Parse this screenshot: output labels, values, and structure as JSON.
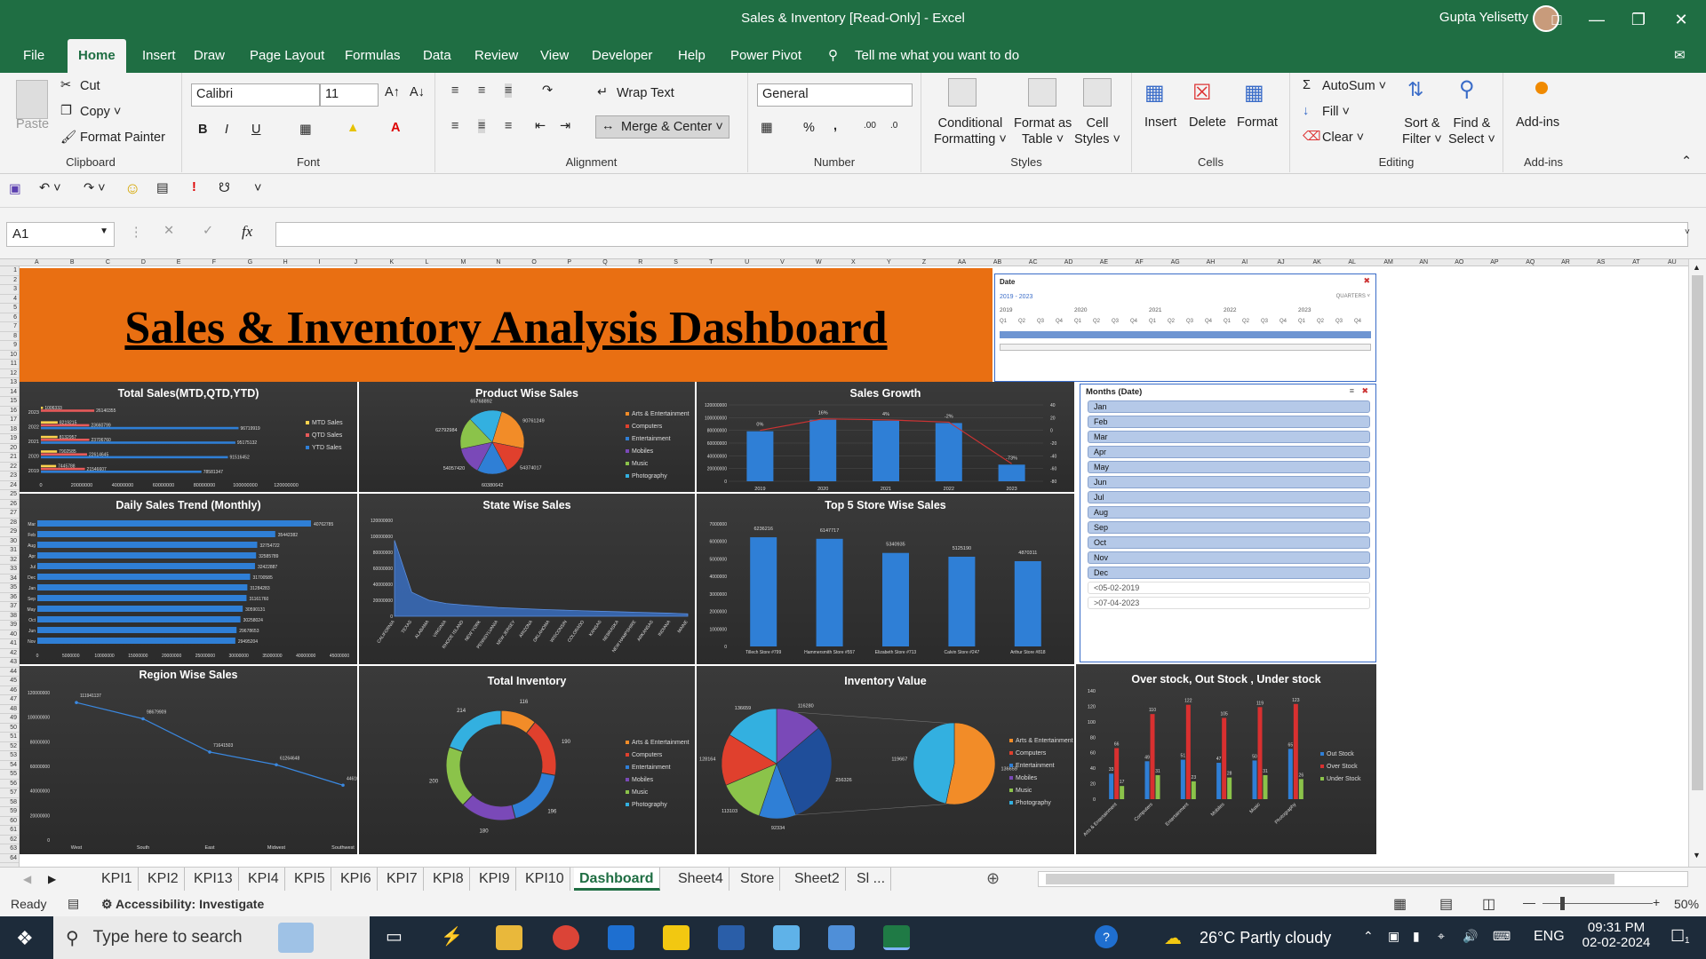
{
  "window": {
    "title": "Sales & Inventory  [Read-Only]  -  Excel",
    "user": "Gupta Yelisetty"
  },
  "ribbon_tabs": [
    "File",
    "Home",
    "Insert",
    "Draw",
    "Page Layout",
    "Formulas",
    "Data",
    "Review",
    "View",
    "Developer",
    "Help",
    "Power Pivot"
  ],
  "tell_me": "Tell me what you want to do",
  "clipboard": {
    "paste": "Paste",
    "cut": "Cut",
    "copy": "Copy",
    "format_painter": "Format Painter",
    "label": "Clipboard"
  },
  "font": {
    "name": "Calibri",
    "size": "11",
    "bold": "B",
    "italic": "I",
    "underline": "U",
    "label": "Font"
  },
  "alignment": {
    "wrap": "Wrap Text",
    "merge": "Merge & Center",
    "label": "Alignment"
  },
  "number": {
    "format": "General",
    "pct": "%",
    "comma": ",",
    "label": "Number"
  },
  "styles": {
    "cond1": "Conditional",
    "cond2": "Formatting",
    "fmt1": "Format as",
    "fmt2": "Table",
    "cell1": "Cell",
    "cell2": "Styles",
    "label": "Styles"
  },
  "cells": {
    "insert": "Insert",
    "delete": "Delete",
    "format": "Format",
    "label": "Cells"
  },
  "editing": {
    "autosum": "AutoSum",
    "fill": "Fill",
    "clear": "Clear",
    "sort1": "Sort &",
    "sort2": "Filter",
    "find1": "Find &",
    "find2": "Select",
    "label": "Editing"
  },
  "addins": {
    "btn": "Add-ins",
    "label": "Add-ins"
  },
  "namebox": "A1",
  "fx": "fx",
  "columns": [
    "A",
    "B",
    "C",
    "D",
    "E",
    "F",
    "G",
    "H",
    "I",
    "J",
    "K",
    "L",
    "M",
    "N",
    "O",
    "P",
    "Q",
    "R",
    "S",
    "T",
    "U",
    "V",
    "W",
    "X",
    "Y",
    "Z",
    "AA",
    "AB",
    "AC",
    "AD",
    "AE",
    "AF",
    "AG",
    "AH",
    "AI",
    "AJ",
    "AK",
    "AL",
    "AM",
    "AN",
    "AO",
    "AP",
    "AQ",
    "AR",
    "AS",
    "AT",
    "AU"
  ],
  "dashboard_title": "Sales & Inventory Analysis Dashboard",
  "panels": {
    "total_sales": "Total Sales(MTD,QTD,YTD)",
    "product_sales": "Product Wise Sales",
    "sales_growth": "Sales Growth",
    "daily_trend": "Daily Sales Trend (Monthly)",
    "state_sales": "State Wise Sales",
    "top5": "Top 5 Store Wise Sales",
    "region": "Region Wise Sales",
    "total_inventory": "Total Inventory",
    "inventory_value": "Inventory Value",
    "stock": "Over stock, Out Stock , Under stock"
  },
  "date_slicer": {
    "title": "Date",
    "range": "2019 - 2023",
    "level": "QUARTERS",
    "years": [
      "2019",
      "2020",
      "2021",
      "2022",
      "2023"
    ],
    "quarters": [
      "Q1",
      "Q2",
      "Q3",
      "Q4"
    ]
  },
  "months_slicer": {
    "title": "Months (Date)",
    "items": [
      "Jan",
      "Feb",
      "Mar",
      "Apr",
      "May",
      "Jun",
      "Jul",
      "Aug",
      "Sep",
      "Oct",
      "Nov",
      "Dec"
    ],
    "extra": [
      "<05-02-2019",
      ">07-04-2023"
    ]
  },
  "sheets": [
    "KPI1",
    "KPI2",
    "KPI13",
    "KPI4",
    "KPI5",
    "KPI6",
    "KPI7",
    "KPI8",
    "KPI9",
    "KPI10",
    "Dashboard",
    "Sheet4",
    "Store",
    "Sheet2",
    "Sl ..."
  ],
  "status": {
    "ready": "Ready",
    "accessibility": "Accessibility: Investigate",
    "zoom": "50%"
  },
  "taskbar": {
    "search": "Type here to search",
    "weather": "26°C  Partly cloudy",
    "lang": "ENG",
    "time": "09:31 PM",
    "date": "02-02-2024",
    "notif": "1"
  },
  "colors": {
    "excel_green": "#1f6e43",
    "banner": "#e96f12",
    "bar_blue": "#2f7fd6",
    "red": "#d93030",
    "green": "#8bc34a"
  },
  "chart_data": [
    {
      "type": "bar",
      "title": "Total Sales(MTD,QTD,YTD)",
      "orientation": "horizontal",
      "categories": [
        "2023",
        "2022",
        "2021",
        "2020",
        "2019"
      ],
      "series": [
        {
          "name": "MTD Sales",
          "values": [
            1006333,
            8219215,
            8132957,
            7902585,
            7445788
          ]
        },
        {
          "name": "QTD Sales",
          "values": [
            26140355,
            23660799,
            23706760,
            22614645,
            21546607
          ]
        },
        {
          "name": "YTD Sales",
          "values": [
            null,
            96719919,
            95175132,
            91516452,
            78581347
          ]
        }
      ],
      "x_ticks": [
        "0",
        "20000000",
        "40000000",
        "60000000",
        "80000000",
        "100000000",
        "120000000"
      ],
      "xlim": [
        0,
        120000000
      ]
    },
    {
      "type": "pie",
      "title": "Product Wise Sales",
      "categories": [
        "Arts & Entertainment",
        "Computers",
        "Entertainment",
        "Mobiles",
        "Music",
        "Photography"
      ],
      "values": [
        90761249,
        54374017,
        60380642,
        54057420,
        62792984,
        65768892
      ]
    },
    {
      "type": "bar",
      "title": "Sales Growth",
      "categories": [
        "2019",
        "2020",
        "2021",
        "2022",
        "2023"
      ],
      "values": [
        78581347,
        96719919,
        95175132,
        91516452,
        26140355
      ],
      "growth_labels": [
        "0%",
        "16%",
        "4%",
        "-2%",
        "-73%"
      ],
      "y_ticks": [
        "0",
        "20000000",
        "40000000",
        "60000000",
        "80000000",
        "100000000",
        "120000000"
      ],
      "ylim": [
        0,
        120000000
      ],
      "y2_ticks": [
        "40",
        "20",
        "0",
        "-20",
        "-40",
        "-60",
        "-80"
      ]
    },
    {
      "type": "bar",
      "title": "Daily Sales Trend (Monthly)",
      "orientation": "horizontal",
      "categories": [
        "Mar",
        "Feb",
        "Aug",
        "Apr",
        "Jul",
        "Dec",
        "Jan",
        "Sep",
        "May",
        "Oct",
        "Jun",
        "Nov"
      ],
      "values": [
        40762785,
        35442382,
        32754722,
        32585789,
        32422887,
        31700585,
        31284283,
        31161760,
        30590131,
        30258024,
        29678653,
        29495204
      ],
      "x_ticks": [
        "0",
        "5000000",
        "10000000",
        "15000000",
        "20000000",
        "25000000",
        "30000000",
        "35000000",
        "40000000",
        "45000000"
      ],
      "xlim": [
        0,
        45000000
      ]
    },
    {
      "type": "area",
      "title": "State Wise Sales",
      "categories": [
        "CALIFORNIA",
        "TEXAS",
        "ALABAMA",
        "VIRGINIA",
        "RHODE ISLAND",
        "NEW YORK",
        "PENNSYLVANIA",
        "NEW JERSEY",
        "ARIZONA",
        "OKLAHOMA",
        "WISCONSIN",
        "COLORADO",
        "KANSAS",
        "NEBRASKA",
        "NEW HAMPSHIRE",
        "ARKANSAS",
        "INDIANA",
        "MAINE"
      ],
      "values": [
        95000000,
        30000000,
        20000000,
        16000000,
        14000000,
        12500000,
        11000000,
        10000000,
        9000000,
        8200000,
        7500000,
        6800000,
        6200000,
        5600000,
        5000000,
        4400000,
        3800000,
        3000000
      ],
      "y_ticks": [
        "0",
        "20000000",
        "40000000",
        "60000000",
        "80000000",
        "100000000",
        "120000000"
      ],
      "ylim": [
        0,
        120000000
      ]
    },
    {
      "type": "bar",
      "title": "Top 5 Store Wise Sales",
      "categories": [
        "Tillech Store #799",
        "Hammersmith Store #557",
        "Elizabeth Store #713",
        "Calvin Store #247",
        "Arthur Store #818"
      ],
      "values": [
        6236216,
        6147717,
        5340935,
        5125190,
        4870311
      ],
      "y_ticks": [
        "0",
        "1000000",
        "2000000",
        "3000000",
        "4000000",
        "5000000",
        "6000000",
        "7000000"
      ],
      "ylim": [
        0,
        7000000
      ]
    },
    {
      "type": "line",
      "title": "Region Wise Sales",
      "categories": [
        "West",
        "South",
        "East",
        "Midwest",
        "Southwest"
      ],
      "values": [
        111941137,
        98679909,
        71641503,
        61264648,
        44610017
      ],
      "y_ticks": [
        "0",
        "20000000",
        "40000000",
        "60000000",
        "80000000",
        "100000000",
        "120000000"
      ],
      "ylim": [
        0,
        120000000
      ]
    },
    {
      "type": "pie",
      "title": "Total Inventory",
      "style": "donut",
      "categories": [
        "Arts & Entertainment",
        "Computers",
        "Entertainment",
        "Mobiles",
        "Music",
        "Photography"
      ],
      "values": [
        116,
        190,
        196,
        180,
        200,
        214
      ]
    },
    {
      "type": "pie",
      "title": "Inventory Value",
      "style": "pie-of-pie",
      "categories": [
        "Arts & Entertainment",
        "Computers",
        "Entertainment",
        "Mobiles",
        "Music",
        "Photography"
      ],
      "values": [
        116280,
        256326,
        92334,
        113103,
        128164,
        136659
      ],
      "secondary_values": [
        136659,
        119667
      ]
    },
    {
      "type": "bar",
      "title": "Over stock, Out Stock , Under stock",
      "categories": [
        "Arts & Entertainment",
        "Computers",
        "Entertainment",
        "Mobiles",
        "Music",
        "Photography"
      ],
      "series": [
        {
          "name": "Out Stock",
          "values": [
            33,
            49,
            51,
            47,
            50,
            65
          ]
        },
        {
          "name": "Over Stock",
          "values": [
            66,
            110,
            122,
            105,
            119,
            123
          ]
        },
        {
          "name": "Under Stock",
          "values": [
            17,
            31,
            23,
            28,
            31,
            26
          ]
        }
      ],
      "y_ticks": [
        "0",
        "20",
        "40",
        "60",
        "80",
        "100",
        "120",
        "140"
      ],
      "ylim": [
        0,
        140
      ]
    }
  ]
}
